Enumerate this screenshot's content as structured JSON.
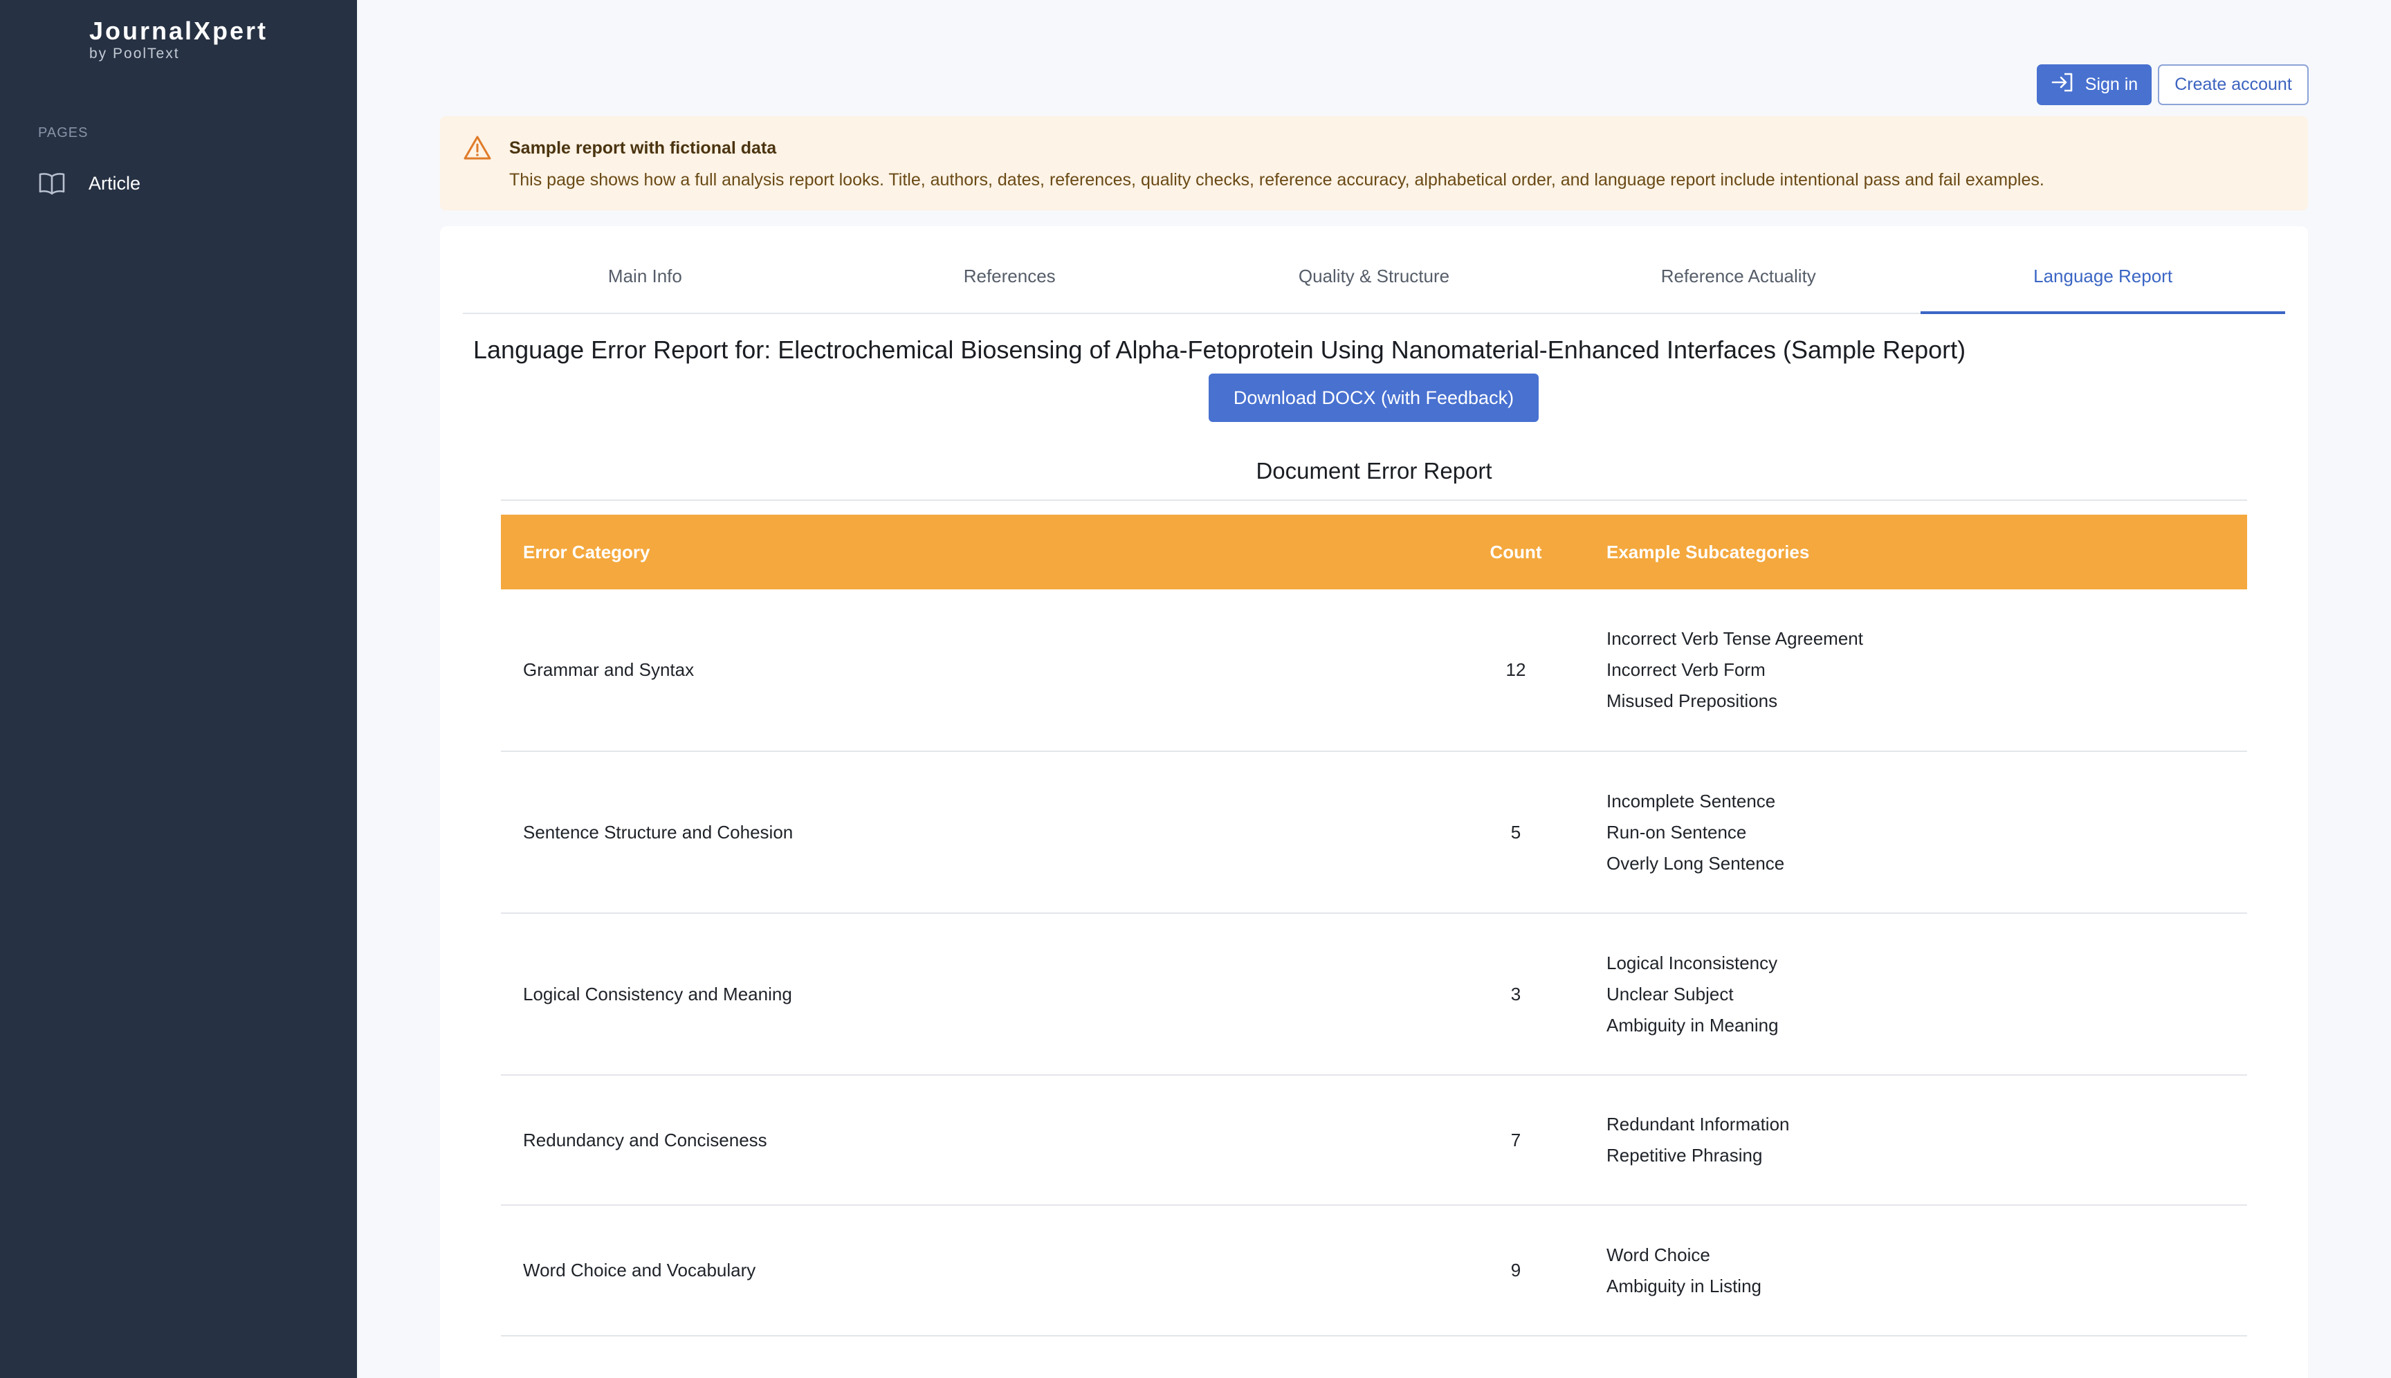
{
  "brand": {
    "name": "JournalXpert",
    "sub": "by PoolText"
  },
  "sidebar": {
    "section_label": "PAGES",
    "items": [
      {
        "label": "Article",
        "icon": "book-open-icon"
      }
    ]
  },
  "header": {
    "sign_in": "Sign in",
    "create_account": "Create account"
  },
  "banner": {
    "title": "Sample report with fictional data",
    "text": "This page shows how a full analysis report looks. Title, authors, dates, references, quality checks, reference accuracy, alphabetical order, and language report include intentional pass and fail examples."
  },
  "tabs": [
    {
      "label": "Main Info",
      "active": false
    },
    {
      "label": "References",
      "active": false
    },
    {
      "label": "Quality & Structure",
      "active": false
    },
    {
      "label": "Reference Actuality",
      "active": false
    },
    {
      "label": "Language Report",
      "active": true
    }
  ],
  "report": {
    "title": "Language Error Report for: Electrochemical Biosensing of Alpha-Fetoprotein Using Nanomaterial-Enhanced Interfaces (Sample Report)",
    "download_label": "Download DOCX (with Feedback)",
    "section_title": "Document Error Report"
  },
  "table": {
    "headers": {
      "category": "Error Category",
      "count": "Count",
      "subcategories": "Example Subcategories"
    },
    "rows": [
      {
        "category": "Grammar and Syntax",
        "count": "12",
        "subcategories": [
          "Incorrect Verb Tense Agreement",
          "Incorrect Verb Form",
          "Misused Prepositions"
        ]
      },
      {
        "category": "Sentence Structure and Cohesion",
        "count": "5",
        "subcategories": [
          "Incomplete Sentence",
          "Run-on Sentence",
          "Overly Long Sentence"
        ]
      },
      {
        "category": "Logical Consistency and Meaning",
        "count": "3",
        "subcategories": [
          "Logical Inconsistency",
          "Unclear Subject",
          "Ambiguity in Meaning"
        ]
      },
      {
        "category": "Redundancy and Conciseness",
        "count": "7",
        "subcategories": [
          "Redundant Information",
          "Repetitive Phrasing"
        ]
      },
      {
        "category": "Word Choice and Vocabulary",
        "count": "9",
        "subcategories": [
          "Word Choice",
          "Ambiguity in Listing"
        ]
      }
    ]
  },
  "colors": {
    "sidebar_bg": "#263143",
    "accent": "#4871d0",
    "table_header": "#f4a83d",
    "banner_bg": "#fdf3e6",
    "warning": "#e07b2a"
  }
}
